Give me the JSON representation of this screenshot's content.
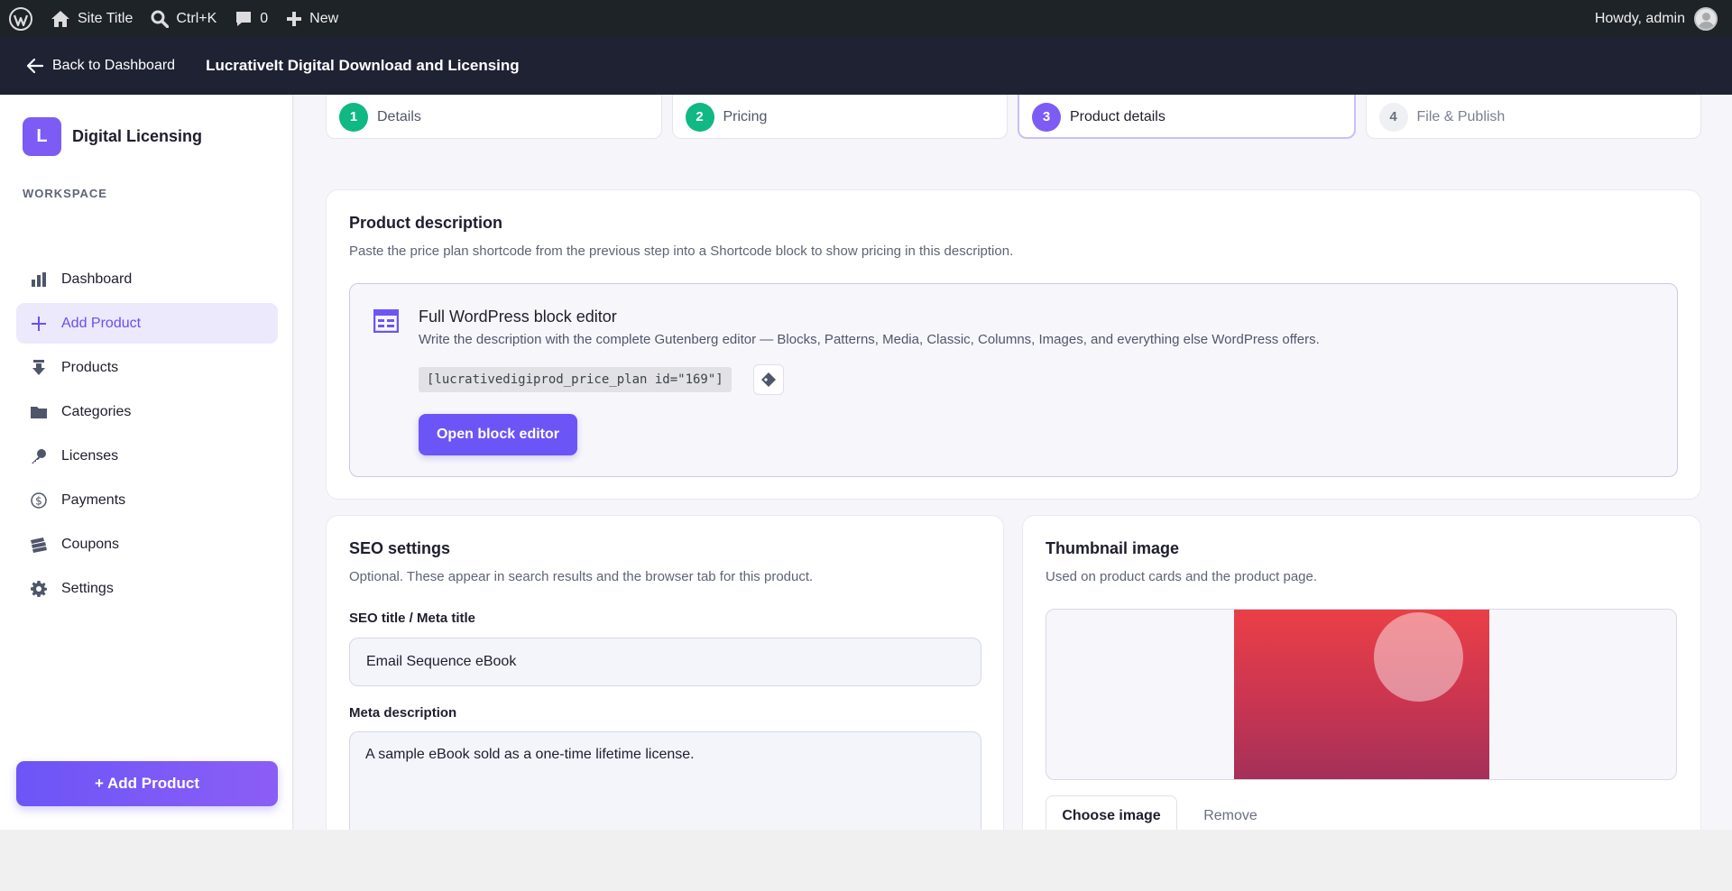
{
  "adminbar": {
    "site_title": "Site Title",
    "search_shortcut": "Ctrl+K",
    "comments_count": "0",
    "new_label": "New",
    "howdy": "Howdy, admin"
  },
  "header": {
    "back_label": "Back to Dashboard",
    "plugin_title": "LucrativeIt Digital Download and Licensing"
  },
  "sidebar": {
    "brand_initial": "L",
    "brand_name": "Digital Licensing",
    "section_label": "WORKSPACE",
    "items": [
      {
        "label": "Dashboard",
        "icon": "bar-chart-icon"
      },
      {
        "label": "Add Product",
        "icon": "plus-icon",
        "active": true
      },
      {
        "label": "Products",
        "icon": "download-icon"
      },
      {
        "label": "Categories",
        "icon": "folder-icon"
      },
      {
        "label": "Licenses",
        "icon": "key-icon"
      },
      {
        "label": "Payments",
        "icon": "dollar-icon"
      },
      {
        "label": "Coupons",
        "icon": "tickets-icon"
      },
      {
        "label": "Settings",
        "icon": "gear-icon"
      }
    ],
    "add_button": "+ Add Product"
  },
  "steps": [
    {
      "num": "1",
      "label": "Details",
      "state": "done"
    },
    {
      "num": "2",
      "label": "Pricing",
      "state": "done"
    },
    {
      "num": "3",
      "label": "Product details",
      "state": "current"
    },
    {
      "num": "4",
      "label": "File & Publish",
      "state": "todo"
    }
  ],
  "description": {
    "title": "Product description",
    "subtitle": "Paste the price plan shortcode from the previous step into a Shortcode block to show pricing in this description.",
    "editor_title": "Full WordPress block editor",
    "editor_subtitle": "Write the description with the complete Gutenberg editor — Blocks, Patterns, Media, Classic, Columns, Images, and everything else WordPress offers.",
    "shortcode": "[lucrativedigiprod_price_plan id=\"169\"]",
    "open_button": "Open block editor"
  },
  "seo": {
    "title": "SEO settings",
    "subtitle": "Optional. These appear in search results and the browser tab for this product.",
    "meta_title_label": "SEO title / Meta title",
    "meta_title_value": "Email Sequence eBook",
    "meta_desc_label": "Meta description",
    "meta_desc_value": "A sample eBook sold as a one-time lifetime license."
  },
  "thumbnail": {
    "title": "Thumbnail image",
    "subtitle": "Used on product cards and the product page.",
    "choose_button": "Choose image",
    "remove_button": "Remove"
  },
  "colors": {
    "accent": "#7c5cf5",
    "done": "#10b981",
    "header_bg": "#1e2233",
    "adminbar_bg": "#1d2327"
  }
}
